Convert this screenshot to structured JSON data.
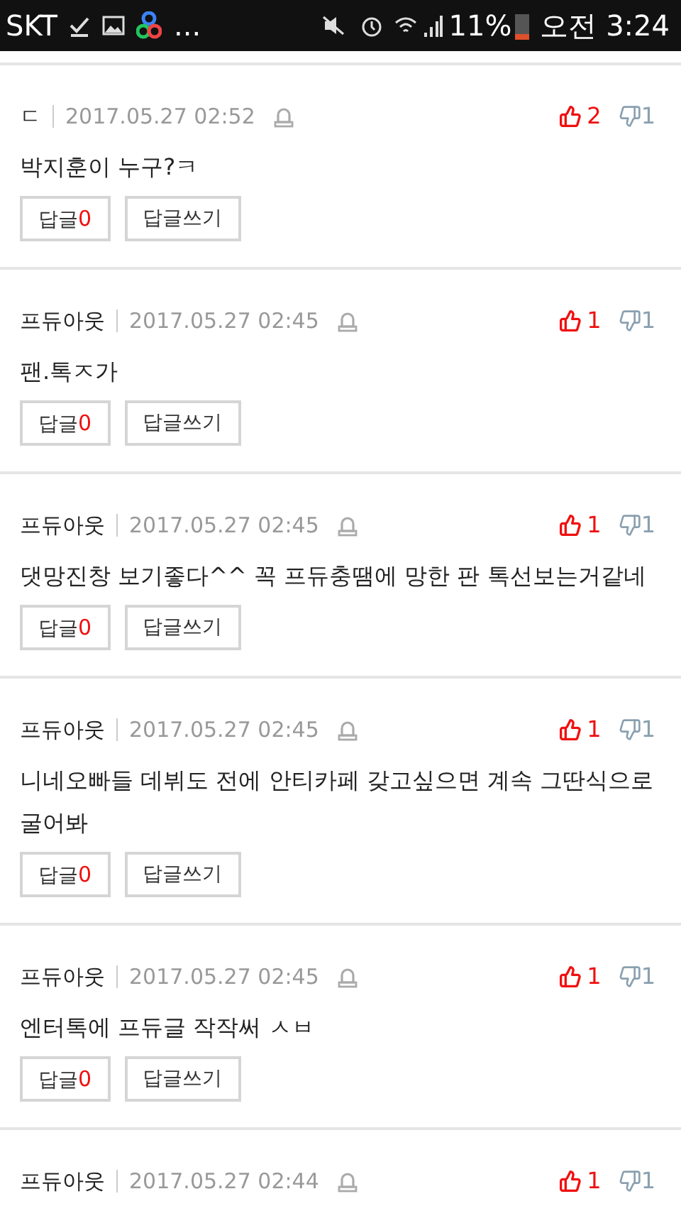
{
  "status_bar": {
    "carrier": "SKT",
    "more": "...",
    "battery_percent": "11%",
    "time": "오전 3:24"
  },
  "comments": [
    {
      "author": "ㄷ",
      "date": "2017.05.27 02:52",
      "likes": "2",
      "dislikes": "1",
      "body": "박지훈이 누구?ㅋ",
      "reply_label": "답글",
      "reply_count": "0",
      "write_label": "답글쓰기"
    },
    {
      "author": "프듀아웃",
      "date": "2017.05.27 02:45",
      "likes": "1",
      "dislikes": "1",
      "body": "팬.톡ㅈ가",
      "reply_label": "답글",
      "reply_count": "0",
      "write_label": "답글쓰기"
    },
    {
      "author": "프듀아웃",
      "date": "2017.05.27 02:45",
      "likes": "1",
      "dislikes": "1",
      "body": "댓망진창 보기좋다^^ 꼭 프듀충땜에 망한 판 톡선보는거같네",
      "reply_label": "답글",
      "reply_count": "0",
      "write_label": "답글쓰기"
    },
    {
      "author": "프듀아웃",
      "date": "2017.05.27 02:45",
      "likes": "1",
      "dislikes": "1",
      "body": "니네오빠들 데뷔도 전에 안티카페 갖고싶으면 계속 그딴식으로 굴어봐",
      "reply_label": "답글",
      "reply_count": "0",
      "write_label": "답글쓰기"
    },
    {
      "author": "프듀아웃",
      "date": "2017.05.27 02:45",
      "likes": "1",
      "dislikes": "1",
      "body": "엔터톡에 프듀글 작작써 ㅅㅂ",
      "reply_label": "답글",
      "reply_count": "0",
      "write_label": "답글쓰기"
    },
    {
      "author": "프듀아웃",
      "date": "2017.05.27 02:44",
      "likes": "1",
      "dislikes": "1"
    }
  ]
}
